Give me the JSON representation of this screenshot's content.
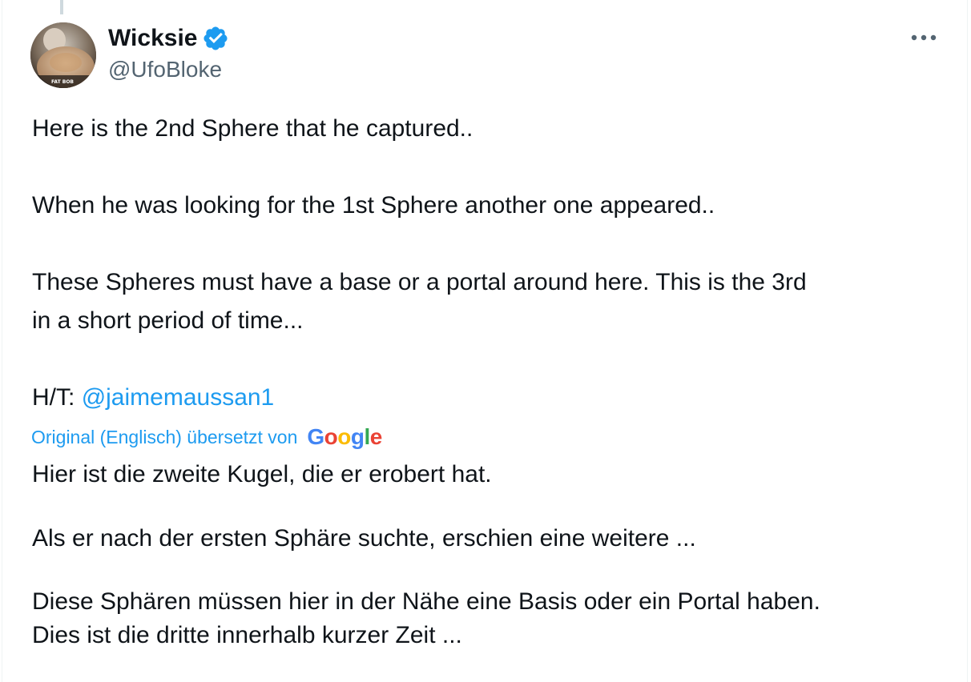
{
  "tweet": {
    "author": {
      "display_name": "Wicksie",
      "handle": "@UfoBloke",
      "avatar_caption": "FAT BOB",
      "verified": true
    },
    "more_menu_icon": "more-horizontal-icon",
    "text_lines": [
      "Here is the 2nd Sphere that he captured..",
      "When he was looking for the 1st Sphere another one appeared..",
      "These Spheres must have a base or a portal around here. This is the 3rd",
      "in a short period of time..."
    ],
    "hat_tip_prefix": "H/T:",
    "hat_tip_mention": "@jaimemaussan1",
    "translation": {
      "label": "Original (Englisch) übersetzt von",
      "provider": "Google",
      "provider_colors": [
        "#4285F4",
        "#EA4335",
        "#FBBC05",
        "#4285F4",
        "#34A853",
        "#EA4335"
      ],
      "lines": [
        "Hier ist die zweite Kugel, die er erobert hat.",
        "Als er nach der ersten Sphäre suchte, erschien eine weitere ...",
        "Diese Sphären müssen hier in der Nähe eine Basis oder ein Portal haben.",
        "Dies ist die dritte innerhalb kurzer Zeit ..."
      ]
    },
    "colors": {
      "text": "#0f1419",
      "secondary": "#536471",
      "link": "#1d9bf0",
      "verified_badge": "#1d9bf0"
    }
  }
}
